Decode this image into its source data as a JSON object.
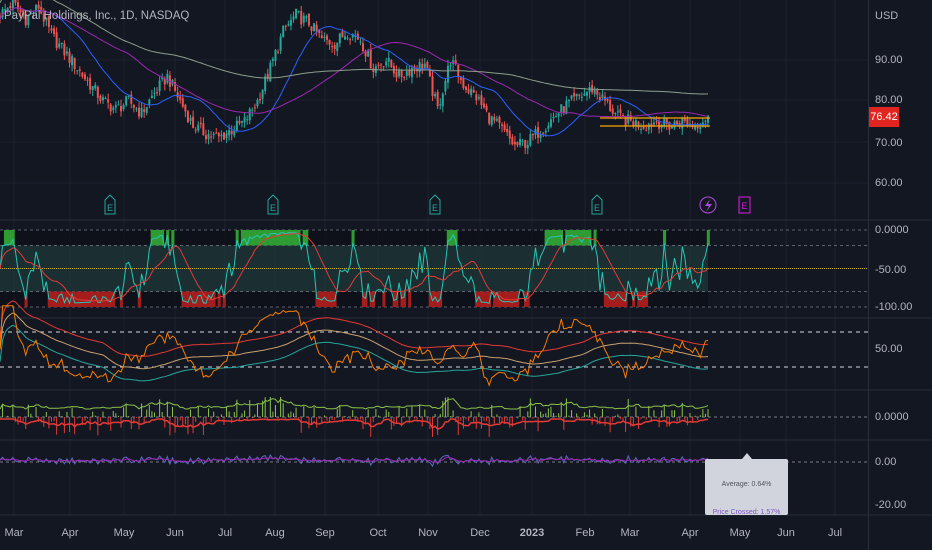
{
  "legend": "PayPal Holdings, Inc., 1D, NASDAQ",
  "currency": "USD",
  "last_price": "76.42",
  "colors": {
    "bg": "#131722",
    "up": "#26a69a",
    "down": "#ef5350",
    "last_price": "#e0241f",
    "ma_fast": "#2962ff",
    "ma_mid": "#9c27b0",
    "ma_slow": "#8d9e8d"
  },
  "price_axis": [
    "90.00",
    "80.00",
    "70.00",
    "60.00"
  ],
  "osc1_axis": [
    "0.0000",
    "-50.00",
    "-100.00"
  ],
  "osc2_axis": [
    "50.00"
  ],
  "osc3_axis": [
    "0.0000"
  ],
  "osc4_axis": [
    "0.00",
    "-20.00"
  ],
  "time_axis": [
    "Mar",
    "Apr",
    "May",
    "Jun",
    "Jul",
    "Aug",
    "Sep",
    "Oct",
    "Nov",
    "Dec",
    "2023",
    "Feb",
    "Mar",
    "Apr",
    "May",
    "Jun",
    "Jul"
  ],
  "events": {
    "earnings_label": "E",
    "dividend_icon": "lightning-icon"
  },
  "tooltip": {
    "average": "Average: 0.64%",
    "price_crossed": "Price Crossed: 1.57%"
  },
  "chart_data": {
    "type": "candlestick",
    "title": "PayPal Holdings, Inc., 1D, NASDAQ",
    "ylabel": "USD",
    "ylim": [
      55,
      105
    ],
    "x_range": [
      "2022-02-22",
      "2023-07-31"
    ],
    "weekly_close_approx": [
      101,
      104,
      100,
      103,
      96,
      92,
      88,
      84,
      80,
      78,
      80,
      77,
      82,
      86,
      80,
      74,
      72,
      71,
      73,
      75,
      80,
      88,
      97,
      101,
      99,
      95,
      94,
      97,
      95,
      88,
      90,
      86,
      88,
      89,
      78,
      90,
      84,
      81,
      76,
      73,
      69,
      70,
      73,
      76,
      79,
      81,
      83,
      80,
      76,
      75,
      74,
      75,
      74,
      75,
      74,
      76.42
    ],
    "earnings_dates": [
      "2022-04-27",
      "2022-08-02",
      "2022-11-03",
      "2023-02-09",
      "2023-05-08"
    ],
    "dividend_date": "2023-04-18"
  }
}
